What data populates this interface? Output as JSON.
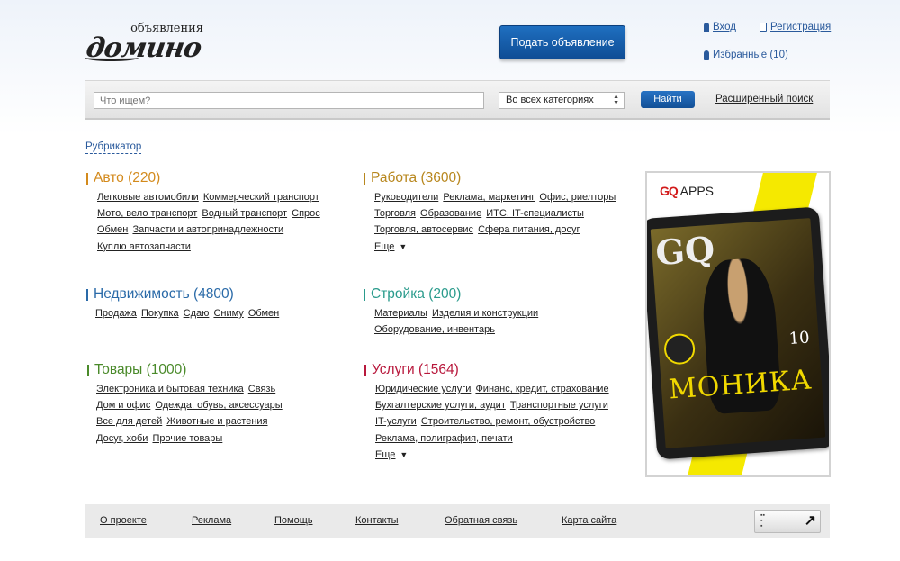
{
  "header": {
    "logo_top": "объявления",
    "logo_main": "домино",
    "post_button": "Подать объявление",
    "login": "Вход",
    "register": "Регистрация",
    "favorites": "Избранные (10)"
  },
  "search": {
    "placeholder": "Что ищем?",
    "category_selected": "Во всех категориях",
    "find_button": "Найти",
    "advanced": "Расширенный поиск"
  },
  "rubricator": "Рубрикатор",
  "categories": [
    {
      "title": "Авто (220)",
      "color": "#d38a1c",
      "links": [
        "Легковые автомобили",
        "Коммерческий транспорт",
        "Мото, вело транспорт",
        "Водный транспорт",
        "Спрос",
        "Обмен",
        "Запчасти и автопринадлежности",
        "Куплю автозапчасти"
      ],
      "more": ""
    },
    {
      "title": "Работа (3600)",
      "color": "#b8871e",
      "links": [
        "Руководители",
        "Реклама, маркетинг",
        "Офис, риелторы",
        "Торговля",
        "Образование",
        "ИТС, IT-специалисты",
        "Торговля, автосервис",
        "Сфера питания, досуг"
      ],
      "more": "Еще"
    },
    {
      "title": "Недвижимость (4800)",
      "color": "#2a6aa8",
      "links": [
        "Продажа",
        "Покупка",
        "Сдаю",
        "Сниму",
        "Обмен"
      ],
      "more": ""
    },
    {
      "title": "Стройка (200)",
      "color": "#2a9b8c",
      "links": [
        "Материалы",
        "Изделия и конструкции",
        "Оборудование, инвентарь"
      ],
      "more": ""
    },
    {
      "title": "Товары (1000)",
      "color": "#4a8a2a",
      "links": [
        "Электроника и бытовая техника",
        "Связь",
        "Дом и офис",
        "Одежда, обувь, аксессуары",
        "Все для детей",
        "Животные и растения",
        "Досуг, хоби",
        "Прочие товары"
      ],
      "more": ""
    },
    {
      "title": "Услуги (1564)",
      "color": "#b8183c",
      "links": [
        "Юридические услуги",
        "Финанс, кредит, страхование",
        "Бухгалтерские услуги, аудит",
        "Транспортные услуги",
        "IT-услуги",
        "Строительство, ремонт, обустройство",
        "Реклама, полиграфия, печати"
      ],
      "more": "Еще"
    }
  ],
  "ad": {
    "logo_gq": "GQ",
    "logo_apps": "APPS",
    "cover_gq": "GQ",
    "cover_name": "МОНИКА",
    "cover_number": "10"
  },
  "footer": {
    "links": [
      "О проекте",
      "Реклама",
      "Помощь",
      "Контакты",
      "Обратная связь",
      "Карта сайта"
    ]
  }
}
